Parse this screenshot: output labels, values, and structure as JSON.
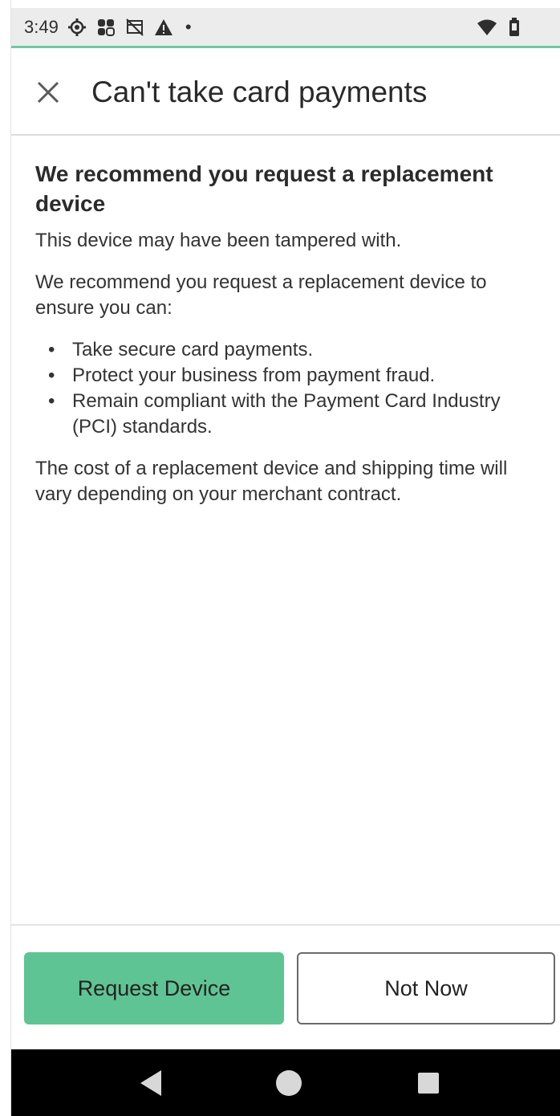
{
  "status_bar": {
    "time": "3:49",
    "left_icons": [
      "settings-icon",
      "clover-icon",
      "no-sim-icon",
      "warning-icon",
      "dot-icon"
    ],
    "right_icons": [
      "wifi-icon",
      "battery-icon"
    ]
  },
  "header": {
    "close_icon": "close-icon",
    "title": "Can't take card payments"
  },
  "content": {
    "heading": "We recommend you request a replacement device",
    "paragraph_1": "This device may have been tampered with.",
    "paragraph_2": "We recommend you request a replacement device to ensure you can:",
    "bullets": [
      "Take secure card payments.",
      "Protect your business from payment fraud.",
      "Remain compliant with the Payment Card Industry (PCI) standards."
    ],
    "paragraph_3": "The cost of a replacement device and shipping time will vary depending on your merchant contract."
  },
  "footer": {
    "primary_label": "Request Device",
    "secondary_label": "Not Now"
  },
  "nav_bar": {
    "icons": [
      "back-icon",
      "home-icon",
      "recents-icon"
    ]
  },
  "colors": {
    "accent": "#5fc493",
    "status_bar_bg": "#ececec",
    "status_underline": "#6fc9a1"
  }
}
